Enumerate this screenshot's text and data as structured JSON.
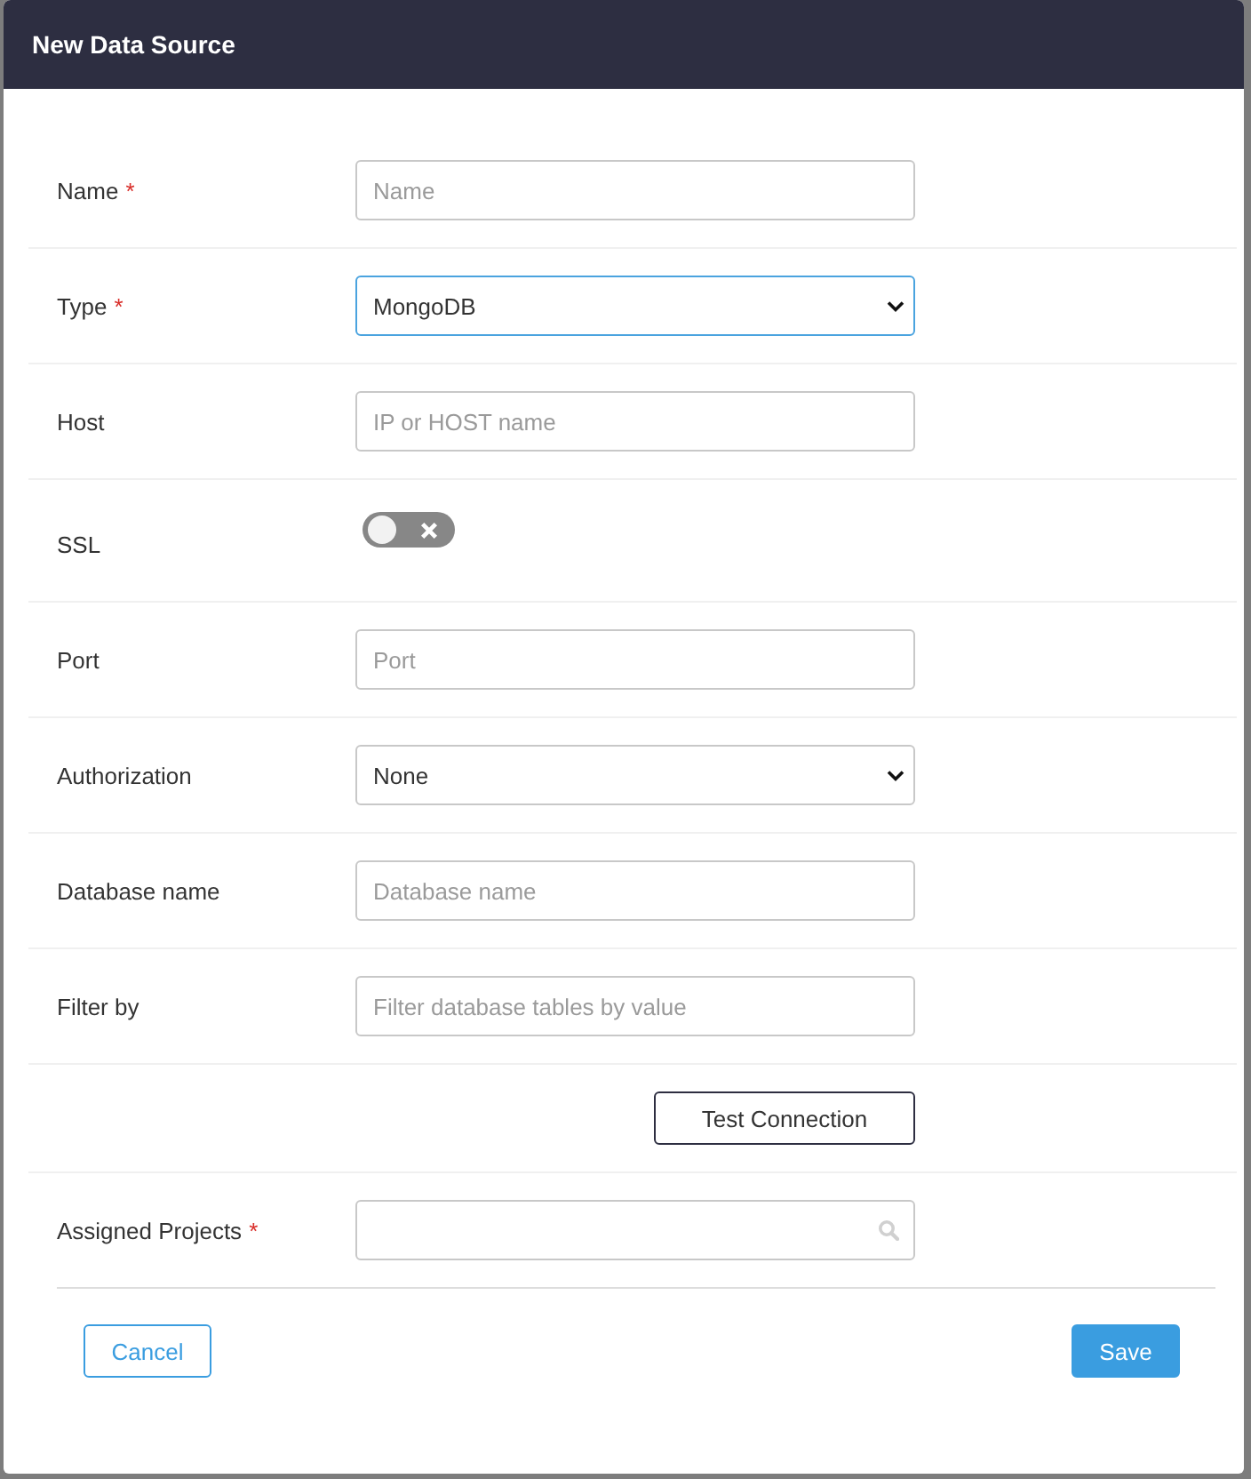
{
  "dialog": {
    "title": "New Data Source"
  },
  "fields": [
    {
      "kind": "text",
      "label": "Name",
      "required_mark": "*",
      "placeholder": "Name",
      "focused": false
    },
    {
      "kind": "select",
      "label": "Type",
      "required_mark": "*",
      "value": "MongoDB",
      "focused": true
    },
    {
      "kind": "text",
      "label": "Host",
      "placeholder": "IP or HOST name",
      "focused": false
    },
    {
      "kind": "toggle",
      "label": "SSL",
      "on": false
    },
    {
      "kind": "text",
      "label": "Port",
      "placeholder": "Port",
      "focused": false
    },
    {
      "kind": "select",
      "label": "Authorization",
      "value": "None",
      "focused": false
    },
    {
      "kind": "text",
      "label": "Database name",
      "placeholder": "Database name",
      "focused": false
    },
    {
      "kind": "text",
      "label": "Filter by",
      "placeholder": "Filter database tables by value",
      "focused": false
    },
    {
      "kind": "button",
      "button": "Test Connection"
    },
    {
      "kind": "search",
      "label": "Assigned Projects",
      "required_mark": "*",
      "focused": false
    }
  ],
  "footer": {
    "buttons": [
      {
        "label": "Cancel",
        "kind": "secondary"
      },
      {
        "label": "Save",
        "kind": "primary"
      }
    ]
  }
}
